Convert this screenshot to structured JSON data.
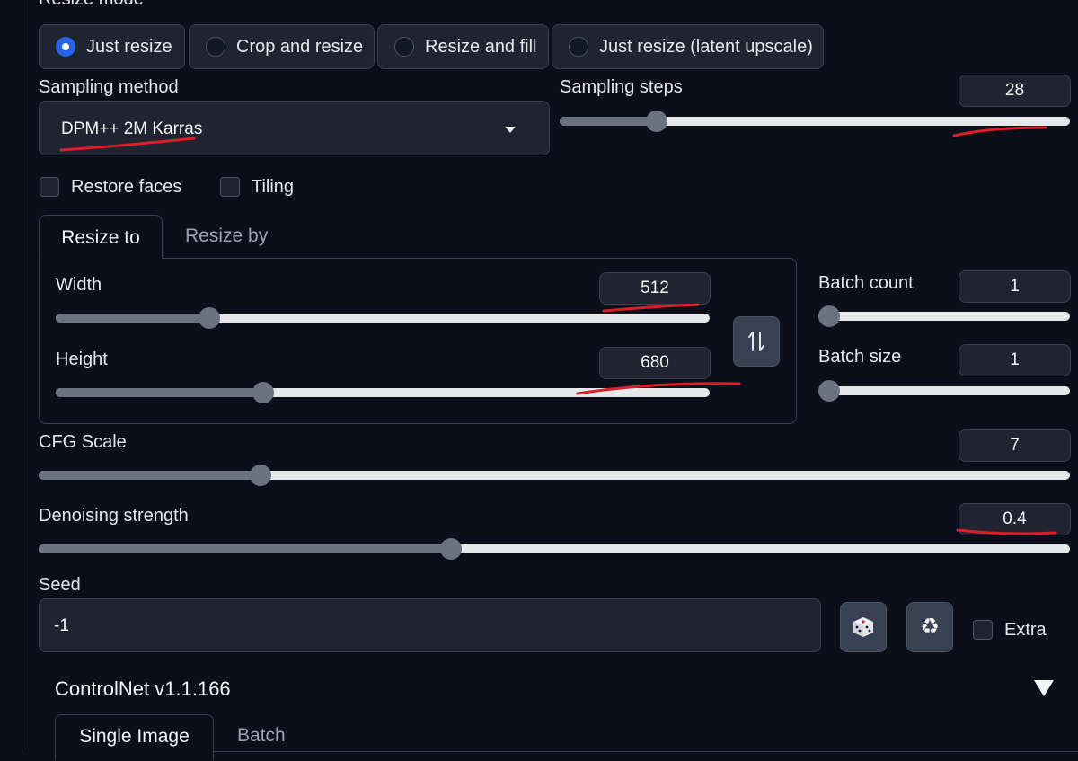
{
  "resize_mode": {
    "label": "Resize mode",
    "options": [
      "Just resize",
      "Crop and resize",
      "Resize and fill",
      "Just resize (latent upscale)"
    ],
    "selected": "Just resize"
  },
  "sampling_method": {
    "label": "Sampling method",
    "value": "DPM++ 2M Karras"
  },
  "sampling_steps": {
    "label": "Sampling steps",
    "value": "28",
    "fraction": 0.19
  },
  "checkboxes": {
    "restore_faces": "Restore faces",
    "tiling": "Tiling"
  },
  "tabs": {
    "resize_to": "Resize to",
    "resize_by": "Resize by"
  },
  "width": {
    "label": "Width",
    "value": "512",
    "fraction": 0.235
  },
  "height": {
    "label": "Height",
    "value": "680",
    "fraction": 0.317
  },
  "batch_count": {
    "label": "Batch count",
    "value": "1",
    "fraction": 0.0
  },
  "batch_size": {
    "label": "Batch size",
    "value": "1",
    "fraction": 0.0
  },
  "cfg_scale": {
    "label": "CFG Scale",
    "value": "7",
    "fraction": 0.215
  },
  "denoising": {
    "label": "Denoising strength",
    "value": "0.4",
    "fraction": 0.4
  },
  "seed": {
    "label": "Seed",
    "value": "-1",
    "extra_label": "Extra"
  },
  "controlnet": {
    "title": "ControlNet v1.1.166",
    "tabs": [
      "Single Image",
      "Batch"
    ]
  },
  "colors": {
    "accent": "#2563eb",
    "background": "#0b0f19",
    "annotation": "#dc1e28"
  },
  "icons": {
    "swap": "swap-dimensions-icon",
    "dice": "dice-icon",
    "recycle": "recycle-icon",
    "collapse": "triangle-down-icon"
  }
}
